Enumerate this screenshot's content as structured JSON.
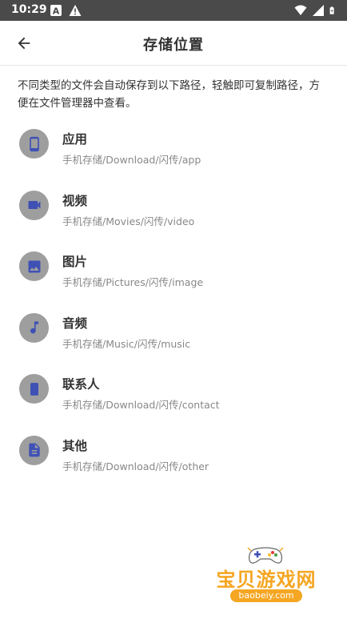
{
  "status_bar": {
    "time": "10:29",
    "left_icons": [
      "a-icon",
      "warning-icon"
    ],
    "right_icons": [
      "wifi-icon",
      "signal-icon",
      "battery-icon"
    ]
  },
  "app_bar": {
    "title": "存储位置",
    "back_icon": "arrow-back-icon"
  },
  "description": "不同类型的文件会自动保存到以下路径，轻触即可复制路径，方便在文件管理器中查看。",
  "storage_items": [
    {
      "name": "应用",
      "path": "手机存储/Download/闪传/app",
      "icon": "phone-icon"
    },
    {
      "name": "视频",
      "path": "手机存储/Movies/闪传/video",
      "icon": "videocam-icon"
    },
    {
      "name": "图片",
      "path": "手机存储/Pictures/闪传/image",
      "icon": "image-icon"
    },
    {
      "name": "音频",
      "path": "手机存储/Music/闪传/music",
      "icon": "music-note-icon"
    },
    {
      "name": "联系人",
      "path": "手机存储/Download/闪传/contact",
      "icon": "contact-card-icon"
    },
    {
      "name": "其他",
      "path": "手机存储/Download/闪传/other",
      "icon": "file-icon"
    }
  ],
  "colors": {
    "status_bar": "#4a4a4a",
    "icon_circle": "#9e9e9e",
    "icon_glyph": "#3f51b5",
    "watermark": "#f5a623"
  },
  "watermark": {
    "title": "宝贝游戏网",
    "url": "baobeiy.com"
  }
}
